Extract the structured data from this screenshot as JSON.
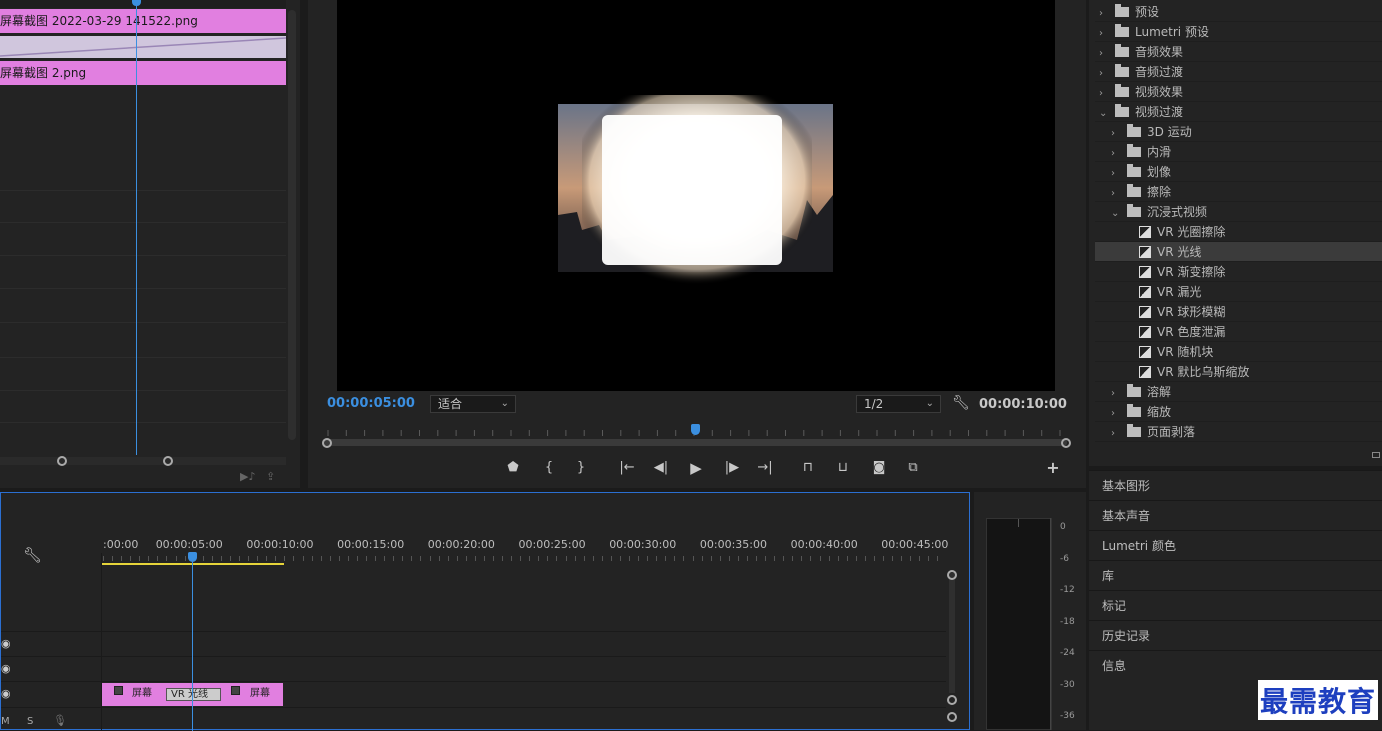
{
  "effect_controls": {
    "clip_a_label": "屏幕截图 2022-03-29 141522.png",
    "clip_b_label": "屏幕截图 2.png"
  },
  "monitor": {
    "current_time": "00:00:05:00",
    "fit_option": "适合",
    "resolution": "1/2",
    "duration": "00:00:10:00",
    "playhead_fraction": 0.5
  },
  "effects_tree": [
    {
      "label": "预设",
      "type": "preset",
      "depth": 0,
      "expanded": false
    },
    {
      "label": "Lumetri 预设",
      "type": "preset",
      "depth": 0,
      "expanded": false
    },
    {
      "label": "音频效果",
      "type": "folder",
      "depth": 0,
      "expanded": false
    },
    {
      "label": "音频过渡",
      "type": "folder",
      "depth": 0,
      "expanded": false
    },
    {
      "label": "视频效果",
      "type": "folder",
      "depth": 0,
      "expanded": false
    },
    {
      "label": "视频过渡",
      "type": "folder",
      "depth": 0,
      "expanded": true
    },
    {
      "label": "3D 运动",
      "type": "folder",
      "depth": 1,
      "expanded": false
    },
    {
      "label": "内滑",
      "type": "folder",
      "depth": 1,
      "expanded": false
    },
    {
      "label": "划像",
      "type": "folder",
      "depth": 1,
      "expanded": false
    },
    {
      "label": "擦除",
      "type": "folder",
      "depth": 1,
      "expanded": false
    },
    {
      "label": "沉浸式视频",
      "type": "folder",
      "depth": 1,
      "expanded": true
    },
    {
      "label": "VR 光圈擦除",
      "type": "item",
      "depth": 2
    },
    {
      "label": "VR 光线",
      "type": "item",
      "depth": 2,
      "selected": true
    },
    {
      "label": "VR 渐变擦除",
      "type": "item",
      "depth": 2
    },
    {
      "label": "VR 漏光",
      "type": "item",
      "depth": 2
    },
    {
      "label": "VR 球形模糊",
      "type": "item",
      "depth": 2
    },
    {
      "label": "VR 色度泄漏",
      "type": "item",
      "depth": 2
    },
    {
      "label": "VR 随机块",
      "type": "item",
      "depth": 2
    },
    {
      "label": "VR 默比乌斯缩放",
      "type": "item",
      "depth": 2
    },
    {
      "label": "溶解",
      "type": "folder",
      "depth": 1,
      "expanded": false
    },
    {
      "label": "缩放",
      "type": "folder",
      "depth": 1,
      "expanded": false
    },
    {
      "label": "页面剥落",
      "type": "folder",
      "depth": 1,
      "expanded": false
    }
  ],
  "panels": [
    "基本图形",
    "基本声音",
    "Lumetri 颜色",
    "库",
    "标记",
    "历史记录",
    "信息"
  ],
  "timeline": {
    "ruler_labels": [
      ":00:00",
      "00:00:05:00",
      "00:00:10:00",
      "00:00:15:00",
      "00:00:20:00",
      "00:00:25:00",
      "00:00:30:00",
      "00:00:35:00",
      "00:00:40:00",
      "00:00:45:00"
    ],
    "clip_a": "屏幕",
    "transition": "VR 光线",
    "clip_b": "屏幕",
    "m_label": "M",
    "s_label": "S"
  },
  "meter": {
    "db_labels": [
      "0",
      "-6",
      "-12",
      "-18",
      "-24",
      "-30",
      "-36"
    ]
  },
  "watermark": "最需教育",
  "colors": {
    "accent_blue": "#3b8fe0",
    "clip_pink": "#e17fe0",
    "panel_bg": "#232323"
  }
}
